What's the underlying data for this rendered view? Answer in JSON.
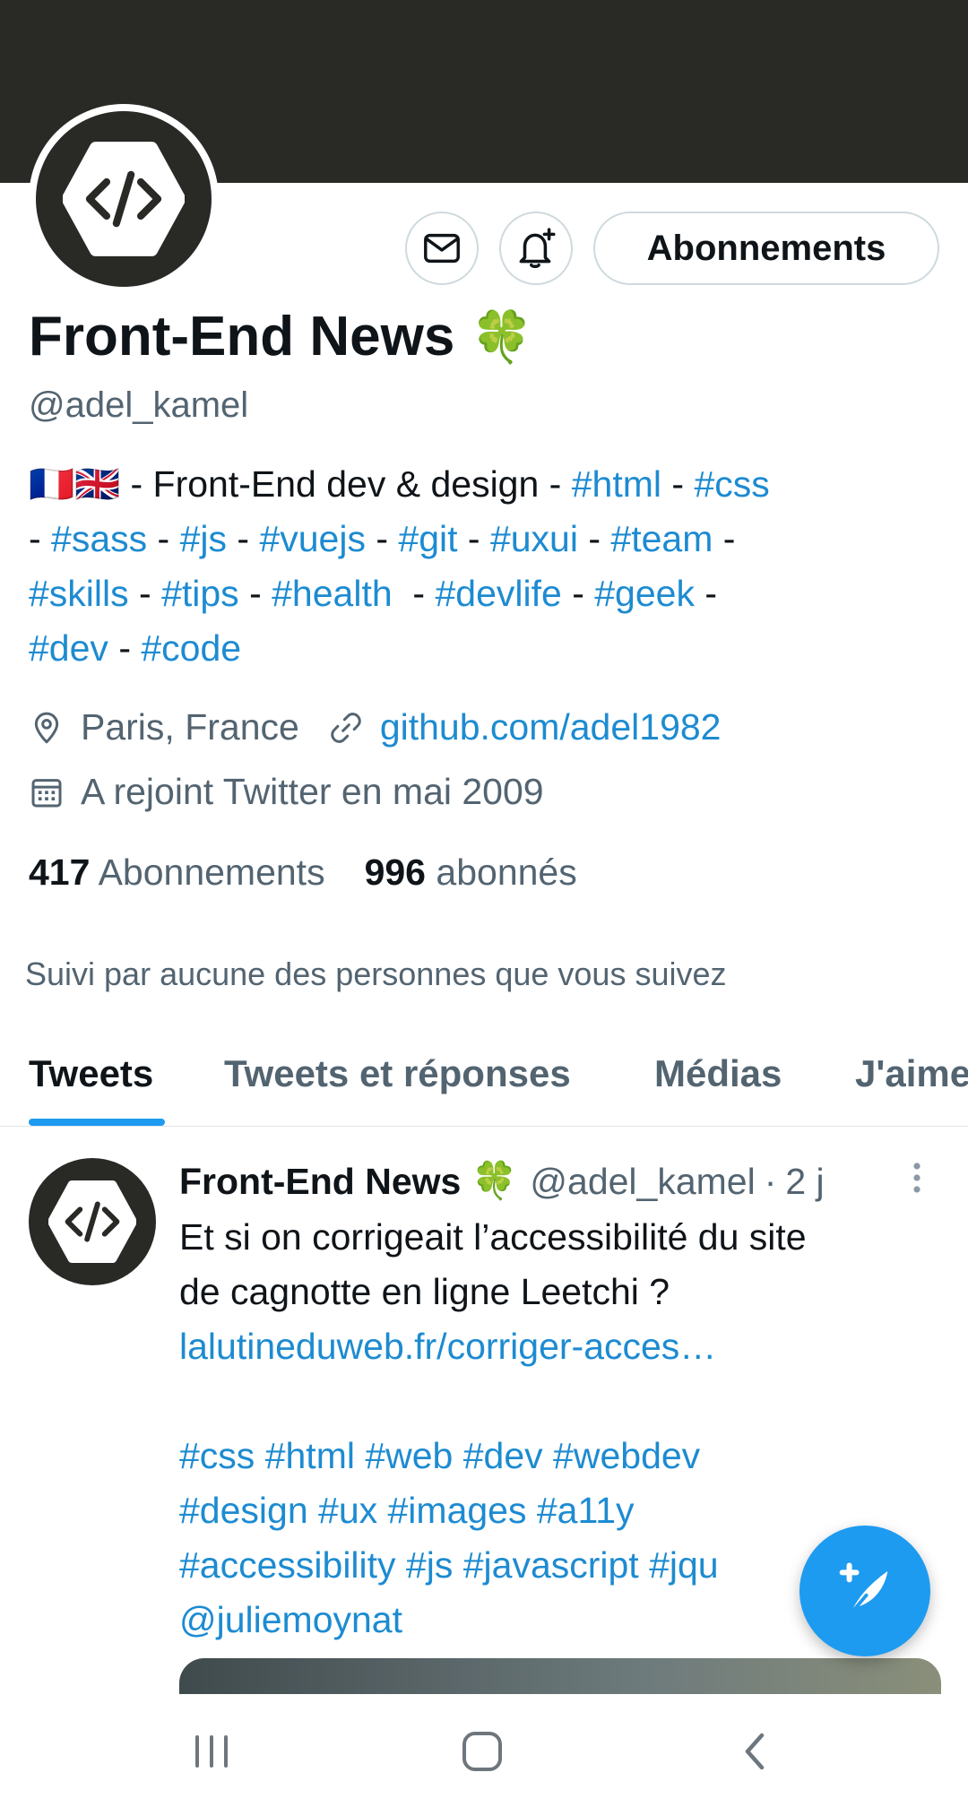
{
  "profile": {
    "name": "Front-End News",
    "name_emoji": "🍀",
    "handle": "@adel_kamel",
    "follow_button_label": "Abonnements",
    "bio": {
      "flags": "🇫🇷🇬🇧",
      "line1_text": " - Front-End dev & design - ",
      "tags": [
        "#html",
        "#css",
        "#sass",
        "#js",
        "#vuejs",
        "#git",
        "#uxui",
        "#team",
        "#skills",
        "#tips",
        "#health",
        "#devlife",
        "#geek",
        "#dev",
        "#code"
      ]
    },
    "location": "Paris, France",
    "website": "github.com/adel1982",
    "joined": "A rejoint Twitter en mai 2009",
    "following_count": "417",
    "following_label": "Abonnements",
    "followers_count": "996",
    "followers_label": "abonnés",
    "followed_by": "Suivi par aucune des personnes que vous suivez"
  },
  "tabs": [
    {
      "label": "Tweets",
      "active": true
    },
    {
      "label": "Tweets et réponses",
      "active": false
    },
    {
      "label": "Médias",
      "active": false
    },
    {
      "label": "J'aime",
      "active": false
    }
  ],
  "tweet": {
    "author_name": "Front-End News",
    "author_emoji": "🍀",
    "author_handle": "@adel_kamel",
    "separator": "·",
    "time": "2 j",
    "text_line1": "Et si on corrigeait l’accessibilité du site",
    "text_line2": "de cagnotte en ligne Leetchi ?",
    "link": "lalutineduweb.fr/corriger-acces…",
    "tags_line1": "#css #html #web #dev #webdev",
    "tags_line2": "#design #ux #images #a11y",
    "tags_line3": "#accessibility #js #javascript #jqu",
    "mention": "@juliemoynat"
  },
  "icons": {
    "avatar": "code-hexagon-icon",
    "message": "envelope-icon",
    "notify": "bell-plus-icon",
    "location": "location-pin-icon",
    "website": "link-icon",
    "joined": "calendar-icon",
    "more": "vertical-dots-icon",
    "compose": "feather-plus-icon",
    "nav_recents": "recents-icon",
    "nav_home": "home-icon",
    "nav_back": "back-icon"
  },
  "colors": {
    "accent": "#1d9bf0",
    "link": "#1d8bd1",
    "banner": "#292926",
    "secondary_text": "#536471"
  }
}
